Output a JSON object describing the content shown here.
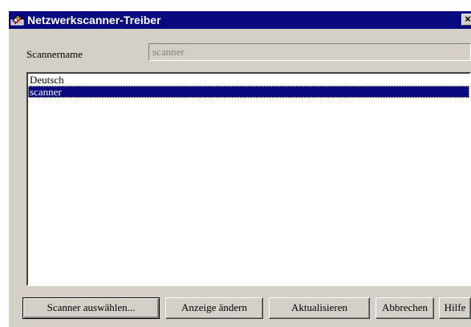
{
  "window": {
    "title": "Netzwerkscanner-Treiber",
    "close_label": "×"
  },
  "scanner_name": {
    "label": "Scannername",
    "value": "scanner"
  },
  "list": {
    "items": [
      {
        "label": "Deutsch",
        "selected": false
      },
      {
        "label": "scanner",
        "selected": true
      }
    ]
  },
  "buttons": {
    "select_scanner": "Scanner auswählen...",
    "change_display": "Anzeige ändern",
    "refresh": "Aktualisieren",
    "cancel": "Abbrechen",
    "help": "Hilfe"
  },
  "colors": {
    "titlebar": "#0a0a80",
    "dialog_face": "#d4d0c8",
    "selection": "#0a0a80"
  },
  "icons": {
    "app": "scanner-app-icon",
    "close": "close-icon"
  }
}
